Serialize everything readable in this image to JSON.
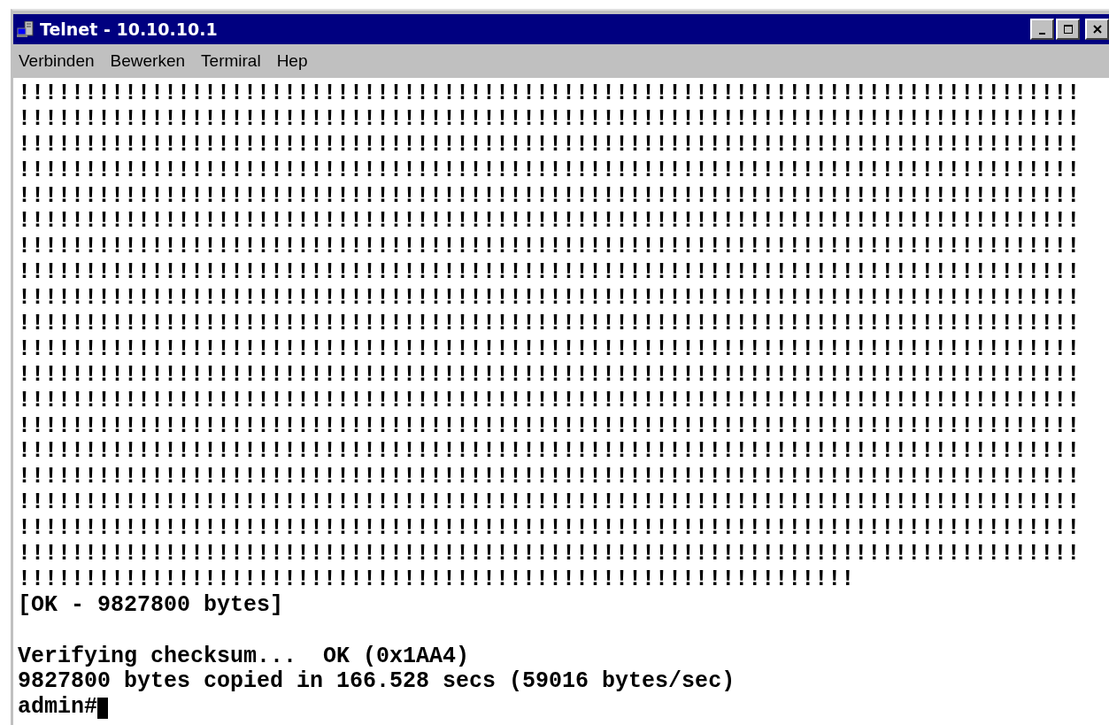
{
  "window": {
    "title": "Telnet - 10.10.10.1"
  },
  "menu": [
    {
      "label": "Verbinden"
    },
    {
      "label": "Bewerken"
    },
    {
      "label": "Termiral"
    },
    {
      "label": "Hep"
    }
  ],
  "terminal": {
    "blocks": [
      [
        "!!!!!!!!!!!!!!!!!!!!!!!!!!!!!!!!!!!!!!!!!!!!!!!!!!!!!!!!!!!!!!!!!!!!!!!!!!!!!!!!",
        "!!!!!!!!!!!!!!!!!!!!!!!!!!!!!!!!!!!!!!!!!!!!!!!!!!!!!!!!!!!!!!!!!!!!!!!!!!!!!!!!",
        "!!!!!!!!!!!!!!!!!!!!!!!!!!!!!!!!!!!!!!!!!!!!!!!!!!!!!!!!!!!!!!!!!!!!!!!!!!!!!!!!",
        "!!!!!!!!!!!!!!!!!!!!!!!!!!!!!!!!!!!!!!!!!!!!!!!!!!!!!!!!!!!!!!!!!!!!!!!!!!!!!!!!",
        "!!!!!!!!!!!!!!!!!!!!!!!!!!!!!!!!!!!!!!!!!!!!!!!!!!!!!!!!!!!!!!!!!!!!!!!!!!!!!!!!",
        "!!!!!!!!!!!!!!!!!!!!!!!!!!!!!!!!!!!!!!!!!!!!!!!!!!!!!!!!!!!!!!!!!!!!!!!!!!!!!!!!",
        "!!!!!!!!!!!!!!!!!!!!!!!!!!!!!!!!!!!!!!!!!!!!!!!!!!!!!!!!!!!!!!!!!!!!!!!!!!!!!!!!",
        "!!!!!!!!!!!!!!!!!!!!!!!!!!!!!!!!!!!!!!!!!!!!!!!!!!!!!!!!!!!!!!!!!!!!!!!!!!!!!!!!",
        "!!!!!!!!!!!!!!!!!!!!!!!!!!!!!!!!!!!!!!!!!!!!!!!!!!!!!!!!!!!!!!!!!!!!!!!!!!!!!!!!",
        "!!!!!!!!!!!!!!!!!!!!!!!!!!!!!!!!!!!!!!!!!!!!!!!!!!!!!!!!!!!!!!!!!!!!!!!!!!!!!!!!",
        "!!!!!!!!!!!!!!!!!!!!!!!!!!!!!!!!!!!!!!!!!!!!!!!!!!!!!!!!!!!!!!!!!!!!!!!!!!!!!!!!",
        "!!!!!!!!!!!!!!!!!!!!!!!!!!!!!!!!!!!!!!!!!!!!!!!!!!!!!!!!!!!!!!!!!!!!!!!!!!!!!!!!",
        "!!!!!!!!!!!!!!!!!!!!!!!!!!!!!!!!!!!!!!!!!!!!!!!!!!!!!!!!!!!!!!!!!!!!!!!!!!!!!!!!",
        "!!!!!!!!!!!!!!!!!!!!!!!!!!!!!!!!!!!!!!!!!!!!!!!!!!!!!!!!!!!!!!!!!!!!!!!!!!!!!!!!",
        "!!!!!!!!!!!!!!!!!!!!!!!!!!!!!!!!!!!!!!!!!!!!!!!!!!!!!!!!!!!!!!!!!!!!!!!!!!!!!!!!",
        "!!!!!!!!!!!!!!!!!!!!!!!!!!!!!!!!!!!!!!!!!!!!!!!!!!!!!!!!!!!!!!!!!!!!!!!!!!!!!!!!",
        "!!!!!!!!!!!!!!!!!!!!!!!!!!!!!!!!!!!!!!!!!!!!!!!!!!!!!!!!!!!!!!!!!!!!!!!!!!!!!!!!",
        "!!!!!!!!!!!!!!!!!!!!!!!!!!!!!!!!!!!!!!!!!!!!!!!!!!!!!!!!!!!!!!!!!!!!!!!!!!!!!!!!",
        "!!!!!!!!!!!!!!!!!!!!!!!!!!!!!!!!!!!!!!!!!!!!!!!!!!!!!!!!!!!!!!!!!!!!!!!!!!!!!!!!",
        "!!!!!!!!!!!!!!!!!!!!!!!!!!!!!!!!!!!!!!!!!!!!!!!!!!!!!!!!!!!!!!!",
        "[OK - 9827800 bytes]"
      ],
      [
        "Verifying checksum...  OK (0x1AA4)",
        "9827800 bytes copied in 166.528 secs (59016 bytes/sec)",
        "admin#"
      ]
    ],
    "cursor": true
  }
}
